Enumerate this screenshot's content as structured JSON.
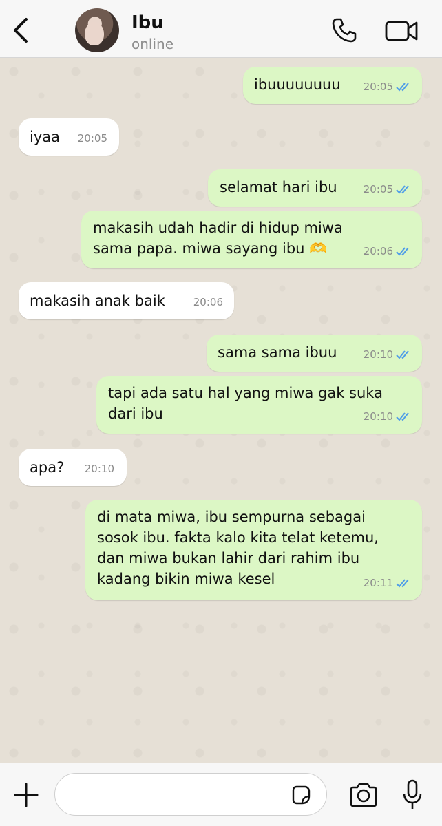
{
  "header": {
    "contact_name": "Ibu",
    "status": "online",
    "icons": [
      "back-icon",
      "call-icon",
      "video-call-icon"
    ]
  },
  "messages": [
    {
      "direction": "outgoing",
      "text": "ibuuuuuuuu",
      "time": "20:05",
      "read": true
    },
    {
      "direction": "incoming",
      "text": "iyaa",
      "time": "20:05"
    },
    {
      "direction": "outgoing",
      "text": "selamat hari ibu",
      "time": "20:05",
      "read": true
    },
    {
      "direction": "outgoing",
      "text": "makasih udah hadir di hidup miwa\nsama papa. miwa sayang ibu 🫶",
      "time": "20:06",
      "read": true
    },
    {
      "direction": "incoming",
      "text": "makasih anak baik",
      "time": "20:06"
    },
    {
      "direction": "outgoing",
      "text": "sama sama ibuu",
      "time": "20:10",
      "read": true
    },
    {
      "direction": "outgoing",
      "text": "tapi ada satu hal yang miwa gak suka\ndari ibu",
      "time": "20:10",
      "read": true
    },
    {
      "direction": "incoming",
      "text": "apa?",
      "time": "20:10"
    },
    {
      "direction": "outgoing",
      "text": "di mata miwa, ibu sempurna sebagai\nsosok ibu. fakta kalo kita telat ketemu,\ndan miwa bukan lahir dari rahim ibu\nkadang bikin miwa kesel",
      "time": "20:11",
      "read": true
    }
  ],
  "composer": {
    "placeholder": "",
    "icons": [
      "plus-icon",
      "sticker-icon",
      "camera-icon",
      "microphone-icon"
    ]
  },
  "colors": {
    "outgoing_bubble": "#dcf7c5",
    "incoming_bubble": "#ffffff",
    "read_ticks": "#4f9de8",
    "chat_background": "#e6e0d6"
  }
}
